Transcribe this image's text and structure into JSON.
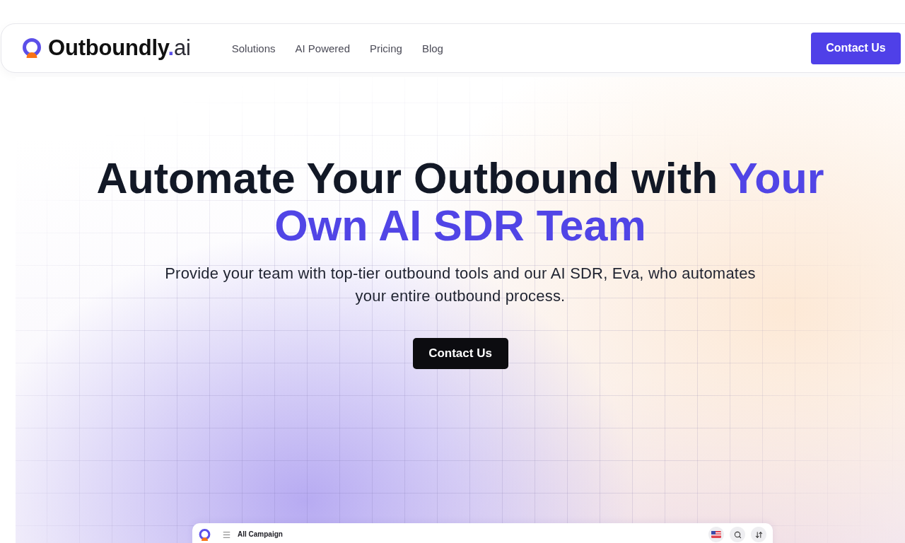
{
  "header": {
    "logo": {
      "wordmark": "Outboundly",
      "separator": ".",
      "suffix": "ai"
    },
    "nav": [
      {
        "label": "Solutions"
      },
      {
        "label": "AI Powered"
      },
      {
        "label": "Pricing"
      },
      {
        "label": "Blog"
      }
    ],
    "cta": "Contact Us"
  },
  "hero": {
    "title": [
      {
        "text": "Automate Your Outbound with ",
        "highlight": false
      },
      {
        "text": "Your Own AI SDR Team",
        "highlight": true
      }
    ],
    "subtitle": "Provide your team with top-tier outbound tools and our AI SDR, Eva, who automates your entire outbound process.",
    "cta": "Contact Us"
  },
  "app_preview": {
    "title": "All Campaign"
  }
}
